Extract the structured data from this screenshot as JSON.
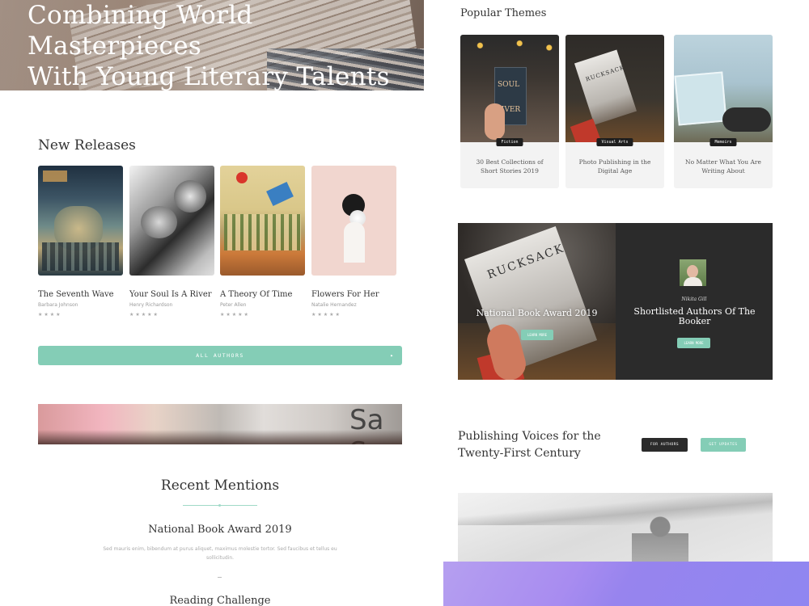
{
  "hero": {
    "title_line1": "Combining World Masterpieces",
    "title_line2": "With Young Literary Talents"
  },
  "new_releases": {
    "title": "New Releases",
    "books": [
      {
        "title": "The Seventh Wave",
        "author": "Barbara Johnson",
        "stars": "★★★★"
      },
      {
        "title": "Your Soul Is A River",
        "author": "Henry Richardson",
        "stars": "★★★★★"
      },
      {
        "title": "A Theory Of Time",
        "author": "Peter Allen",
        "stars": "★★★★★"
      },
      {
        "title": "Flowers For Her",
        "author": "Natalie Hernandez",
        "stars": "★★★★★"
      }
    ],
    "all_authors_label": "ALL AUTHORS",
    "arrow": "▸"
  },
  "strip": {
    "letters": "Sa Sou"
  },
  "recent_mentions": {
    "title": "Recent Mentions",
    "award": "National Book Award 2019",
    "text": "Sed mauris enim, bibendum at purus aliquet, maximus molestie tortor. Sed faucibus et tellus eu sollicitudin.",
    "next": "Reading Challenge"
  },
  "popular_themes": {
    "title": "Popular Themes",
    "cards": [
      {
        "badge": "Fiction",
        "caption": "30 Best Collections of Short Stories 2019",
        "cover_text_1": "SOUL",
        "cover_text_2": "RIVER"
      },
      {
        "badge": "Visual Arts",
        "caption": "Photo Publishing in the Digital Age",
        "cover_text_1": "RUCKSACK",
        "cover_text_2": ""
      },
      {
        "badge": "Memoirs",
        "caption": "No Matter What You Are Writing About",
        "cover_text_1": "",
        "cover_text_2": ""
      }
    ]
  },
  "booker": {
    "magazine": "RUCKSACK",
    "left_title": "National Book Award 2019",
    "left_button": "LEARN MORE",
    "name": "Nikita Gill",
    "right_title": "Shortlisted Authors Of The Booker",
    "right_button": "LEARN MORE"
  },
  "publishing": {
    "title": "Publishing Voices for the Twenty-First Century",
    "btn_dark": "FOR AUTHORS",
    "btn_mint": "GET UPDATES"
  },
  "colors": {
    "mint": "#84cdb6",
    "dark": "#2b2b2b",
    "purple": "#a88cf0"
  }
}
